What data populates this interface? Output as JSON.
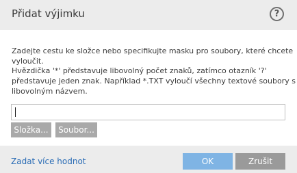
{
  "dialog": {
    "title": "Přidat výjimku",
    "help_label": "?",
    "description_lines": [
      "Zadejte cestu ke složce nebo specifikujte masku pro soubory, které chcete",
      "vyloučit.",
      "Hvězdička '*' představuje libovolný počet znaků, zatímco otazník '?'",
      "představuje jeden znak. Například *.TXT vyloučí všechny textové soubory s",
      "libovolným názvem."
    ],
    "path_input": {
      "value": "",
      "placeholder": ""
    },
    "folder_button_label": "Složka...",
    "file_button_label": "Soubor...",
    "more_values_link": "Zadat více hodnot",
    "ok_label": "OK",
    "cancel_label": "Zrušit"
  },
  "colors": {
    "header_bg": "#ececec",
    "footer_bg": "#ececec",
    "ok_button": "#7fb4e4",
    "cancel_button": "#9a9a9a",
    "secondary_button": "#a9a9a9",
    "link": "#2a6cb5"
  },
  "icons": {
    "help": "question-circle-icon"
  }
}
